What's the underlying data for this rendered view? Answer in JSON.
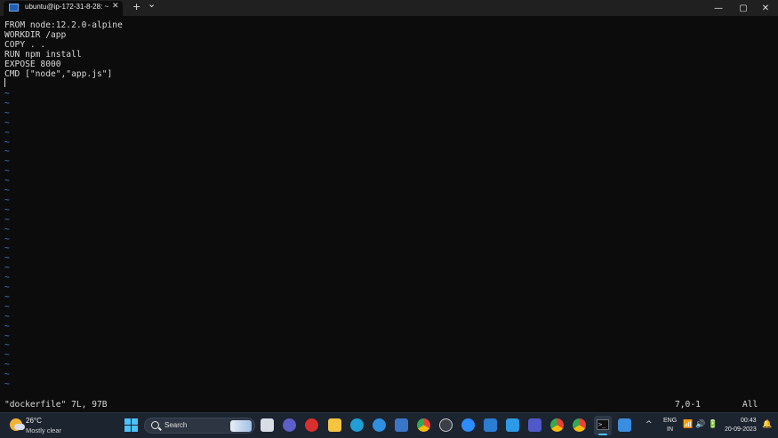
{
  "tab": {
    "title": "ubuntu@ip-172-31-8-28: ~",
    "close": "✕",
    "add": "+",
    "dropdown": "⌄"
  },
  "window_controls": {
    "minimize": "—",
    "maximize": "▢",
    "close": "✕"
  },
  "editor": {
    "lines": [
      "FROM node:12.2.0-alpine",
      "WORKDIR /app",
      "COPY . .",
      "RUN npm install",
      "EXPOSE 8000",
      "CMD [\"node\",\"app.js\"]"
    ],
    "tilde": "~",
    "status_file": "\"dockerfile\" 7L, 97B",
    "status_position": "7,0-1",
    "status_scroll": "All"
  },
  "taskbar": {
    "weather_temp": "26°C",
    "weather_desc": "Mostly clear",
    "search_label": "Search",
    "lang_top": "ENG",
    "lang_bottom": "IN",
    "time": "00:43",
    "date": "20-09-2023",
    "tray_chevron": "^"
  },
  "colors": {
    "terminal_bg": "#0c0c0c",
    "tilde": "#4a7fd6",
    "taskbar_bg": "#1c2430",
    "accent": "#4cc2ff"
  }
}
